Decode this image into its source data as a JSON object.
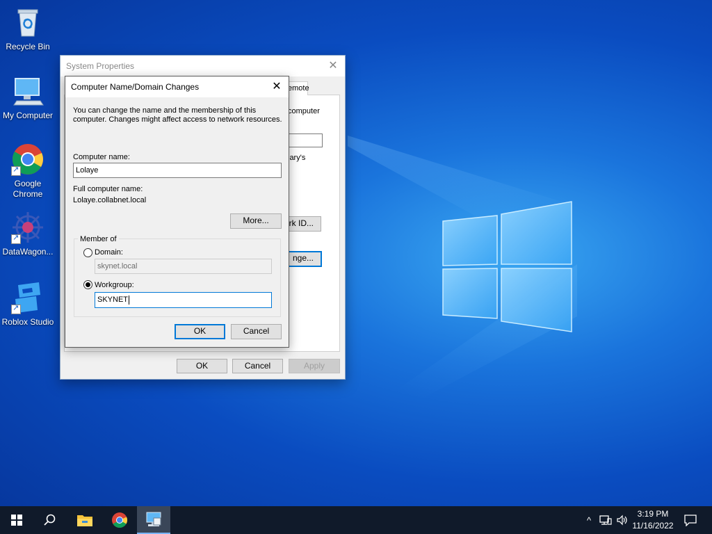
{
  "desktop": {
    "icons": [
      {
        "label": "Recycle Bin"
      },
      {
        "label": "My Computer"
      },
      {
        "label": "Google Chrome"
      },
      {
        "label": "DataWagon..."
      },
      {
        "label": "Roblox Studio"
      }
    ]
  },
  "system_properties": {
    "title": "System Properties",
    "tab_fragment": "emote",
    "fragments": {
      "computer": "computer",
      "library": "lary's",
      "network_id_button": "ork ID...",
      "change_button": "nge..."
    },
    "buttons": {
      "ok": "OK",
      "cancel": "Cancel",
      "apply": "Apply"
    }
  },
  "dialog": {
    "title": "Computer Name/Domain Changes",
    "description_line1": "You can change the name and the membership of this",
    "description_line2": "computer. Changes might affect access to network resources.",
    "computer_name_label": "Computer name:",
    "computer_name_value": "Lolaye",
    "full_name_label": "Full computer name:",
    "full_name_value": "Lolaye.collabnet.local",
    "more_button": "More...",
    "member_of_label": "Member of",
    "domain_label": "Domain:",
    "domain_value": "skynet.local",
    "domain_selected": false,
    "workgroup_label": "Workgroup:",
    "workgroup_value": "SKYNET",
    "workgroup_selected": true,
    "ok_button": "OK",
    "cancel_button": "Cancel"
  },
  "taskbar": {
    "apps": [
      {
        "icon": "windows-start-icon"
      },
      {
        "icon": "search-icon"
      },
      {
        "icon": "file-explorer-icon"
      },
      {
        "icon": "chrome-icon"
      },
      {
        "icon": "system-properties-icon",
        "active": true
      }
    ],
    "tray": {
      "chevron": "^",
      "time": "3:19 PM",
      "date": "11/16/2022"
    }
  },
  "colors": {
    "accent": "#0078d7",
    "taskbar": "#101a2a",
    "desktop": "#0a4cc0"
  }
}
